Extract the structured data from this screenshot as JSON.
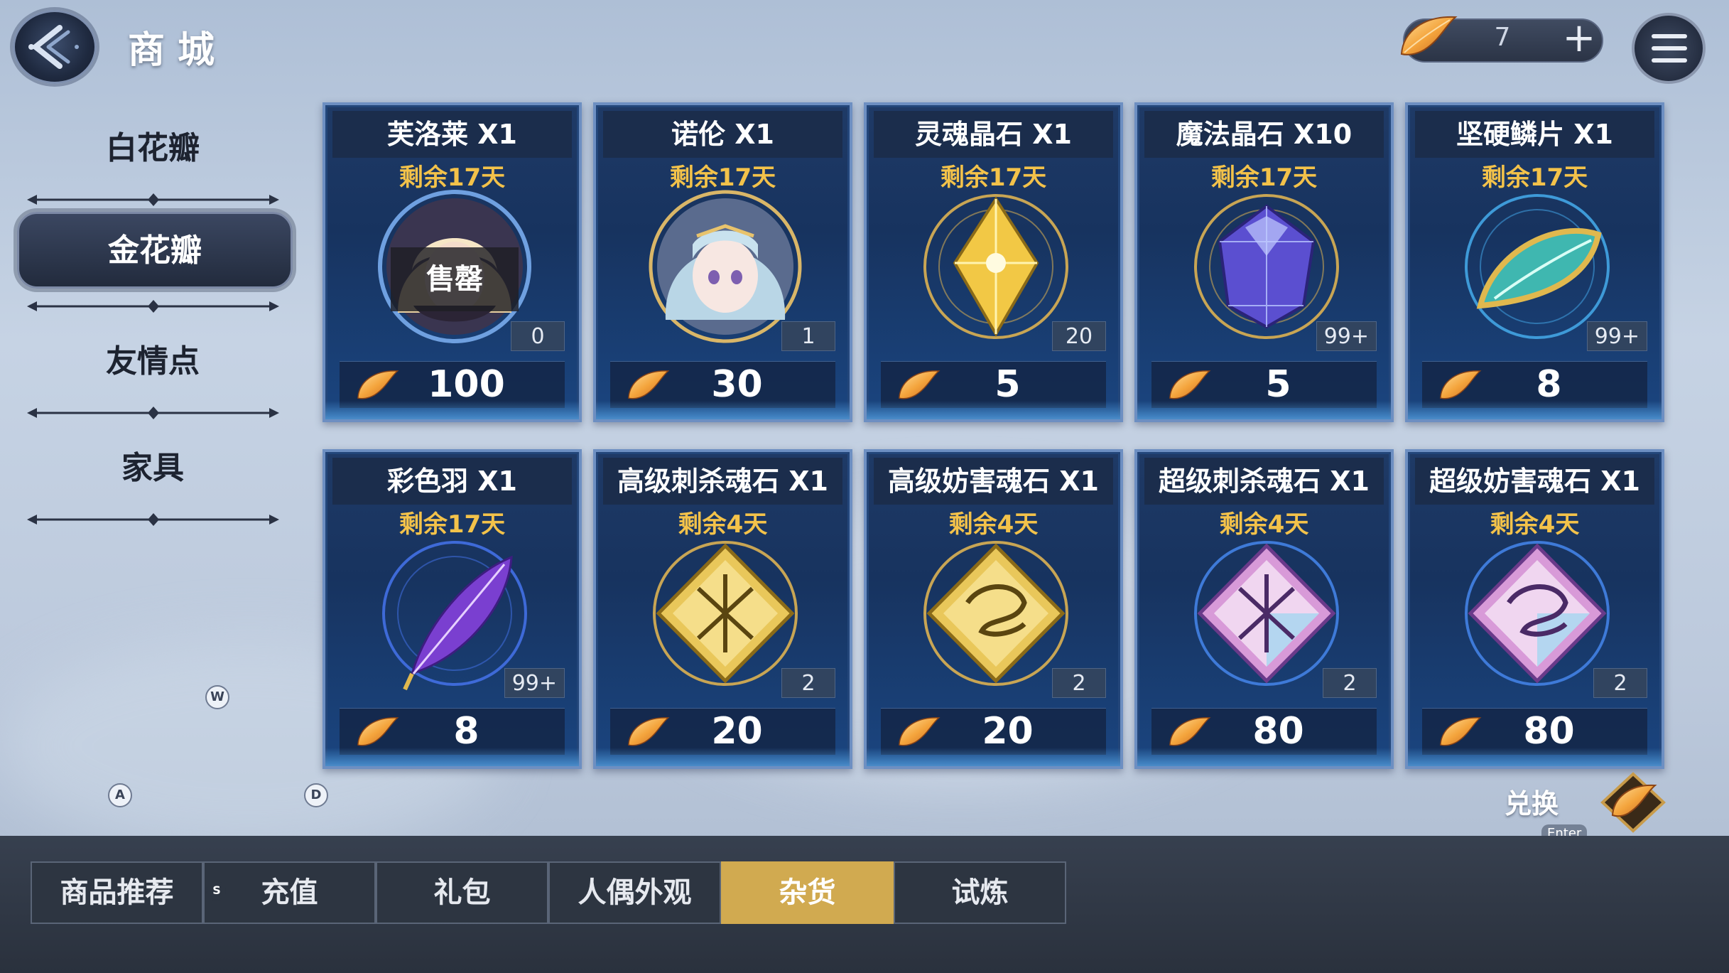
{
  "header": {
    "title": "商城",
    "currency": {
      "value": "7",
      "plus_label": "+"
    }
  },
  "sidebar": {
    "items": [
      {
        "label": "白花瓣",
        "active": false
      },
      {
        "label": "金花瓣",
        "active": true
      },
      {
        "label": "友情点",
        "active": false
      },
      {
        "label": "家具",
        "active": false
      }
    ]
  },
  "key_hints": {
    "w": "W",
    "a": "A",
    "d": "D",
    "s": "S"
  },
  "cards": [
    {
      "name": "芙洛莱 X1",
      "remain": "剩余17天",
      "count": "0",
      "price": "100",
      "sold": "售罄",
      "icon": "character-portrait-blonde"
    },
    {
      "name": "诺伦 X1",
      "remain": "剩余17天",
      "count": "1",
      "price": "30",
      "icon": "character-portrait-silver-hair"
    },
    {
      "name": "灵魂晶石 X1",
      "remain": "剩余17天",
      "count": "20",
      "price": "5",
      "icon": "gold-crystal"
    },
    {
      "name": "魔法晶石 X10",
      "remain": "剩余17天",
      "count": "99+",
      "price": "5",
      "icon": "purple-crystal"
    },
    {
      "name": "坚硬鳞片 X1",
      "remain": "剩余17天",
      "count": "99+",
      "price": "8",
      "icon": "scale"
    },
    {
      "name": "彩色羽 X1",
      "remain": "剩余17天",
      "count": "99+",
      "price": "8",
      "icon": "feather"
    },
    {
      "name": "高级刺杀魂石 X1",
      "remain": "剩余4天",
      "count": "2",
      "price": "20",
      "icon": "gold-soulstone-sword"
    },
    {
      "name": "高级妨害魂石 X1",
      "remain": "剩余4天",
      "count": "2",
      "price": "20",
      "icon": "gold-soulstone-dragon"
    },
    {
      "name": "超级刺杀魂石 X1",
      "remain": "剩余4天",
      "count": "2",
      "price": "80",
      "icon": "prism-soulstone-sword"
    },
    {
      "name": "超级妨害魂石 X1",
      "remain": "剩余4天",
      "count": "2",
      "price": "80",
      "icon": "prism-soulstone-dragon"
    }
  ],
  "exchange": {
    "label": "兑换",
    "key": "Enter"
  },
  "tabs": [
    {
      "label": "商品推荐",
      "active": false
    },
    {
      "label": "充值",
      "active": false
    },
    {
      "label": "礼包",
      "active": false
    },
    {
      "label": "人偶外观",
      "active": false
    },
    {
      "label": "杂货",
      "active": true
    },
    {
      "label": "试炼",
      "active": false
    }
  ],
  "colors": {
    "accent_gold": "#d1aa50",
    "remain_text": "#f3c24a",
    "card_bg": "#1f3a66"
  }
}
